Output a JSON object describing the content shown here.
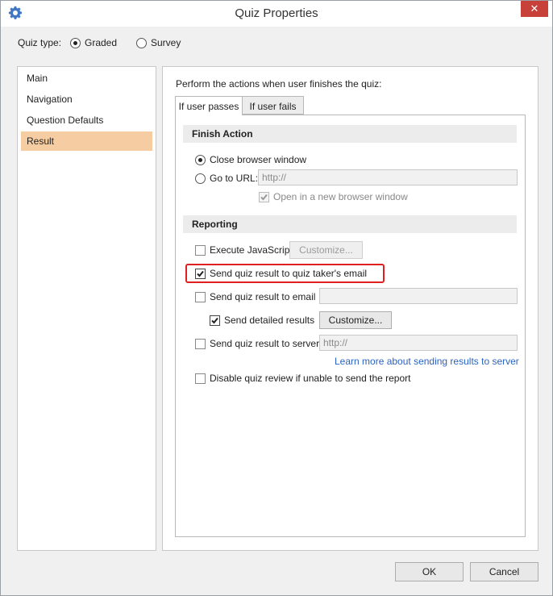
{
  "window": {
    "title": "Quiz Properties",
    "close_label": "✕"
  },
  "quiz_type": {
    "label": "Quiz type:",
    "options": [
      "Graded",
      "Survey"
    ],
    "selected": "Graded"
  },
  "nav": {
    "items": [
      "Main",
      "Navigation",
      "Question Defaults",
      "Result"
    ],
    "selected": "Result"
  },
  "result": {
    "intro": "Perform the actions when user finishes the quiz:",
    "tabs": [
      "If user passes",
      "If user fails"
    ],
    "finish_action": {
      "title": "Finish Action",
      "close_browser": "Close browser window",
      "go_to_url": "Go to URL:",
      "url_placeholder": "http://",
      "open_new_window": "Open in a new browser window"
    },
    "reporting": {
      "title": "Reporting",
      "execute_js": "Execute JavaScript",
      "customize": "Customize...",
      "send_to_taker": "Send quiz result to quiz taker's email",
      "send_to_email": "Send quiz result to email",
      "send_detailed": "Send detailed results",
      "send_to_server": "Send quiz result to server",
      "server_placeholder": "http://",
      "learn_more": "Learn more about sending results to server",
      "disable_review": "Disable quiz review if unable to send the report"
    }
  },
  "footer": {
    "ok": "OK",
    "cancel": "Cancel"
  },
  "colors": {
    "accent": "#f6cda3",
    "highlight": "#e02020",
    "link": "#2a63c2",
    "close": "#c7403a"
  }
}
